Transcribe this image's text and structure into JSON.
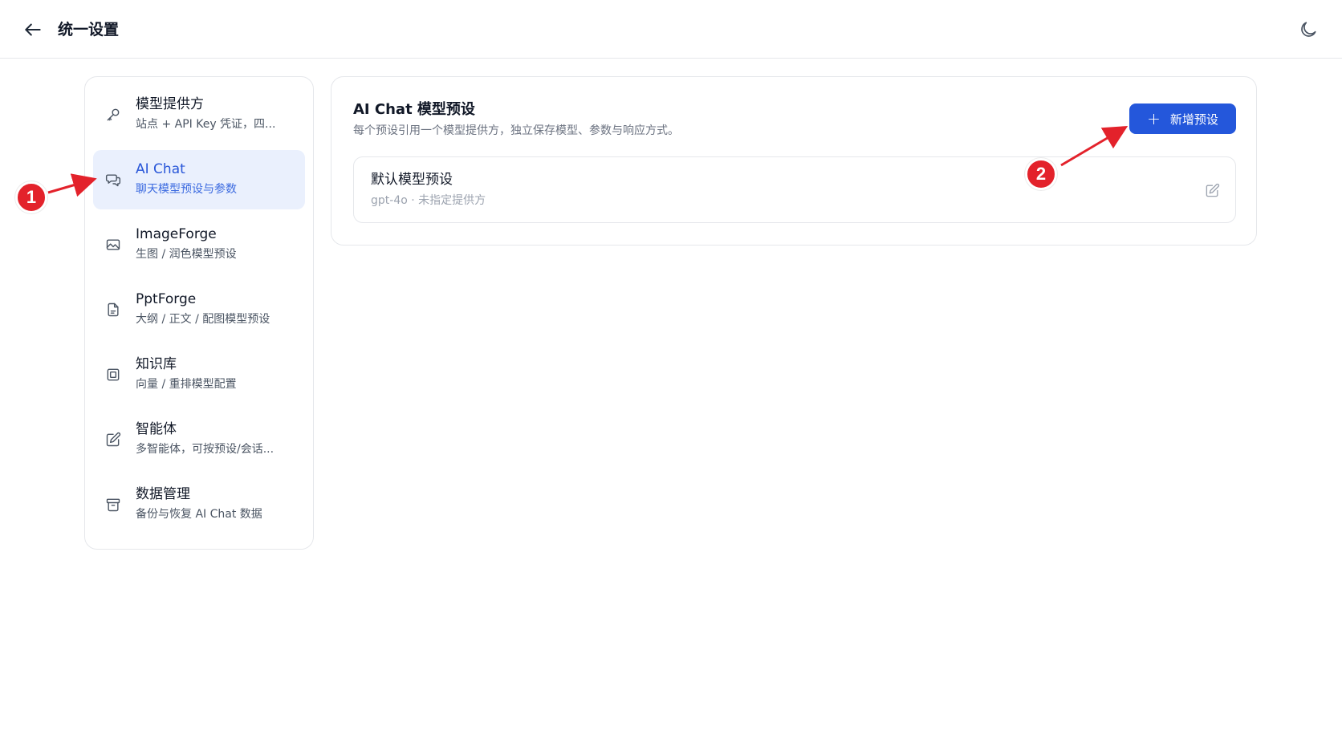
{
  "header": {
    "title": "统一设置",
    "back_icon": "arrow-left-icon",
    "theme_icon": "moon-icon"
  },
  "sidebar": {
    "active_index": 1,
    "items": [
      {
        "id": "providers",
        "title": "模型提供方",
        "subtitle": "站点 + API Key 凭证，四...",
        "icon": "key-icon"
      },
      {
        "id": "ai-chat",
        "title": "AI Chat",
        "subtitle": "聊天模型预设与参数",
        "icon": "chat-icon"
      },
      {
        "id": "imageforge",
        "title": "ImageForge",
        "subtitle": "生图 / 润色模型预设",
        "icon": "image-icon"
      },
      {
        "id": "pptforge",
        "title": "PptForge",
        "subtitle": "大纲 / 正文 / 配图模型预设",
        "icon": "file-icon"
      },
      {
        "id": "knowledge",
        "title": "知识库",
        "subtitle": "向量 / 重排模型配置",
        "icon": "book-icon"
      },
      {
        "id": "agents",
        "title": "智能体",
        "subtitle": "多智能体，可按预设/会话...",
        "icon": "edit-icon"
      },
      {
        "id": "data",
        "title": "数据管理",
        "subtitle": "备份与恢复 AI Chat 数据",
        "icon": "archive-icon"
      }
    ]
  },
  "main": {
    "title": "AI Chat 模型预设",
    "subtitle": "每个预设引用一个模型提供方，独立保存模型、参数与响应方式。",
    "add_button": {
      "label": "新增预设",
      "icon_text": "+"
    },
    "presets": [
      {
        "name": "默认模型预设",
        "meta": "gpt-4o · 未指定提供方"
      }
    ]
  },
  "annotations": {
    "badge_1": "1",
    "badge_2": "2",
    "color": "#e3222b"
  },
  "colors": {
    "accent": "#2457db",
    "active_bg": "#eaf0fd",
    "active_text": "#2856d8",
    "border": "#e5e7eb"
  }
}
